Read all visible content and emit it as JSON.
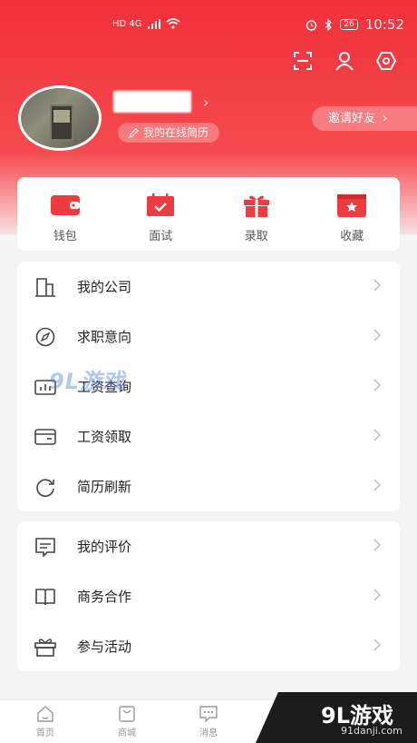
{
  "status_bar": {
    "network": "HD 4G",
    "battery": "26",
    "time": "10:52"
  },
  "colors": {
    "brand": "#f0303a",
    "icon_red": "#ee3b3f"
  },
  "profile": {
    "resume_label": "我的在线简历",
    "invite_label": "邀请好友"
  },
  "quick_actions": [
    {
      "label": "钱包",
      "icon": "wallet-icon"
    },
    {
      "label": "面试",
      "icon": "calendar-check-icon"
    },
    {
      "label": "录取",
      "icon": "gift-icon"
    },
    {
      "label": "收藏",
      "icon": "star-box-icon"
    }
  ],
  "menu_group_1": [
    {
      "label": "我的公司",
      "icon": "building-icon"
    },
    {
      "label": "求职意向",
      "icon": "compass-icon"
    },
    {
      "label": "工资查询",
      "icon": "chart-icon"
    },
    {
      "label": "工资领取",
      "icon": "card-icon"
    },
    {
      "label": "简历刷新",
      "icon": "refresh-icon"
    }
  ],
  "menu_group_2": [
    {
      "label": "我的评价",
      "icon": "comment-icon"
    },
    {
      "label": "商务合作",
      "icon": "book-icon"
    },
    {
      "label": "参与活动",
      "icon": "gift-outline-icon"
    }
  ],
  "tabbar": [
    {
      "label": "首页",
      "icon": "home-icon"
    },
    {
      "label": "商城",
      "icon": "shop-icon"
    },
    {
      "label": "消息",
      "icon": "message-icon"
    }
  ],
  "watermark": {
    "text": "9L游戏",
    "corner_big": "9L游戏",
    "corner_small": "91danji.com"
  }
}
